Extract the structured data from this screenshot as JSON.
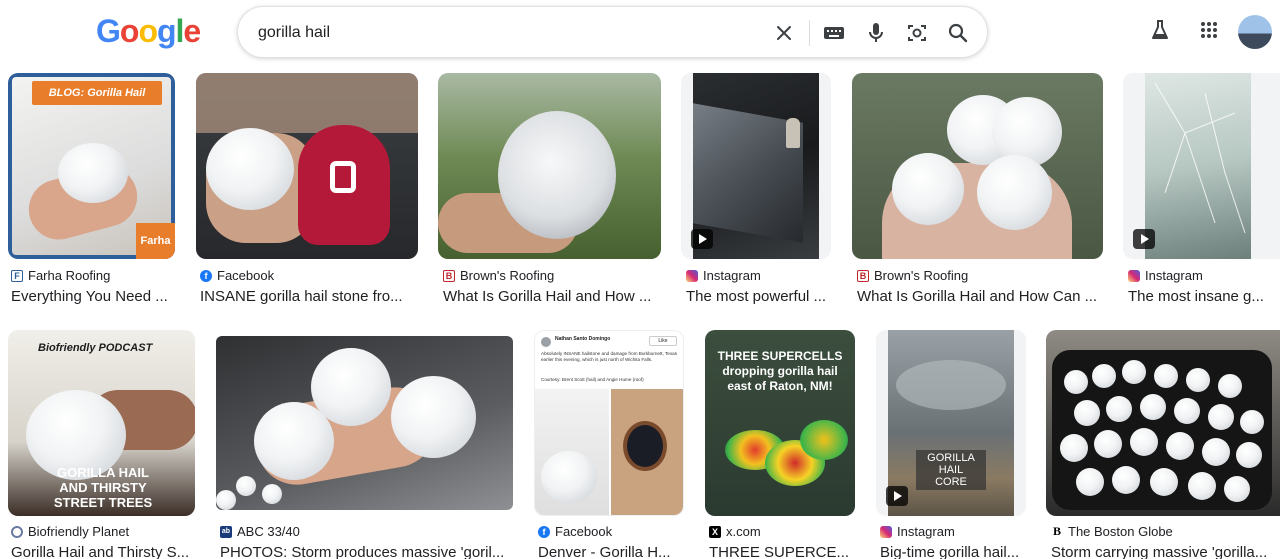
{
  "header": {
    "logo_letters": [
      "G",
      "o",
      "o",
      "g",
      "l",
      "e"
    ],
    "logo_colors": [
      "#4285F4",
      "#EA4335",
      "#FBBC05",
      "#4285F4",
      "#34A853",
      "#EA4335"
    ],
    "search_value": "gorilla hail"
  },
  "icons": {
    "clear": "close-icon",
    "keyboard": "keyboard-icon",
    "mic": "microphone-icon",
    "lens": "camera-search-icon",
    "search": "search-icon",
    "labs": "flask-icon",
    "apps": "apps-grid-icon"
  },
  "results": [
    {
      "source": "Farha Roofing",
      "title": "Everything You Need ...",
      "overlay": "BLOG: Gorilla Hail",
      "brand": "Farha"
    },
    {
      "source": "Facebook",
      "title": "INSANE gorilla hail stone fro..."
    },
    {
      "source": "Brown's Roofing",
      "title": "What Is Gorilla Hail and How ..."
    },
    {
      "source": "Instagram",
      "title": "The most powerful ..."
    },
    {
      "source": "Brown's Roofing",
      "title": "What Is Gorilla Hail and How Can ..."
    },
    {
      "source": "Instagram",
      "title": "The most insane g..."
    },
    {
      "source": "Biofriendly Planet",
      "title": "Gorilla Hail and Thirsty S...",
      "overlay_top": "Biofriendly PODCAST",
      "overlay_lines": [
        "GORILLA HAIL",
        "AND THIRSTY",
        "STREET TREES"
      ]
    },
    {
      "source": "ABC 33/40",
      "title": "PHOTOS: Storm produces massive 'goril..."
    },
    {
      "source": "Facebook",
      "title": "Denver - Gorilla H...",
      "post_author": "Nathan Santo Domingo",
      "post_text": "Absolutely INSANE hailstone and damage from Burkburnett, Texas earlier this evening, which is just north of Wichita Falls.",
      "post_credit": "Courtesy: Brent Scott (hail) and Angie Hume (roof)",
      "like": "Like"
    },
    {
      "source": "x.com",
      "title": "THREE SUPERCE...",
      "overlay_lines": [
        "THREE SUPERCELLS",
        "dropping gorilla hail",
        "east of Raton, NM!"
      ]
    },
    {
      "source": "Instagram",
      "title": "Big-time gorilla hail...",
      "overlay_lines": [
        "GORILLA HAIL",
        "CORE"
      ]
    },
    {
      "source": "The Boston Globe",
      "title": "Storm carrying massive 'gorilla..."
    }
  ]
}
